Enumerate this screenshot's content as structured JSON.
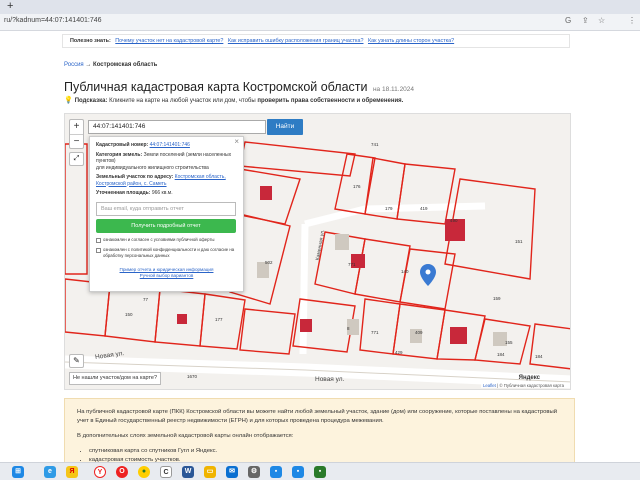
{
  "browser": {
    "new_tab": "+",
    "url": "ru/?kadnum=44:07:141401:746",
    "icons": [
      "translate-icon",
      "share-icon",
      "star-icon",
      "menu-icon"
    ]
  },
  "notice": {
    "label": "Полезно знать:",
    "links": [
      "Почему участок нет на кадастровой карте?",
      "Как исправить ошибку расположения границ участка?",
      "Как узнать длины сторон участка?"
    ]
  },
  "breadcrumb": {
    "root": "Россия",
    "sep": "→",
    "current": "Костромская область"
  },
  "page": {
    "title": "Публичная кадастровая карта Костромской области",
    "date": "на 18.11.2024",
    "hint_label": "Подсказка:",
    "hint_text": "Кликните на карте на любой участок или дом, чтобы",
    "hint_bold": "проверить права собственности и обременения."
  },
  "map": {
    "zoom_in": "+",
    "zoom_out": "−",
    "expand_icon": "⤢",
    "ruler_icon": "✎",
    "search_value": "44:07:141401:746",
    "search_button": "Найти",
    "not_found": "Не нашли участок/дом на карте?",
    "attribution_leaflet": "Leaflet",
    "attribution_rest": "| © Публичная кадастровая карта",
    "yandex": "Яндекс",
    "streets": [
      "Новая ул.",
      "Новая ул.",
      "Каменная ул."
    ],
    "parcel_labels": [
      "741",
      "176",
      "179",
      "419",
      "490",
      "151",
      "502",
      "140",
      "771",
      "159",
      "77",
      "150",
      "177",
      "8",
      "409",
      "771",
      "429",
      "184",
      "155",
      "1670",
      "184"
    ]
  },
  "popup": {
    "close": "×",
    "cad_label": "Кадастровый номер:",
    "cad_value": "44:07:141401:746",
    "cat_label": "Категория земель:",
    "cat_value": "Земли поселений (земли населенных пунктов)",
    "use_value": "для индивидуального жилищного строительства",
    "addr_label": "Земельный участок по адресу:",
    "addr_value": "Костромская область, Костромской район, с. Саметь",
    "area_label": "Уточненная площадь:",
    "area_value": "966 кв.м.",
    "email_placeholder": "Ваш email, куда отправить отчет",
    "get_button": "Получить подробный отчет",
    "agree1": "ознакомлен и согласен с условиями публичной оферты",
    "agree2": "ознакомлен с политикой конфиденциальности и даю согласие на обработку персональных данных",
    "link1": "Пример отчета и юридическая информация",
    "link2": "Ручной выбор вариантов"
  },
  "info": {
    "p1": "На публичной кадастровой карте (ПКК) Костромской области вы можете найти любой земельный участок, здание (дом) или сооружение, которые поставлены на кадастровый учет в Единый государственный реестр недвижимости (ЕГРН) и для которых проведена процедура межевания.",
    "p2": "В дополнительных слоях земельной кадастровой карты онлайн отображается:",
    "items": [
      "спутниковая карта со спутников Гугл и Яндекс.",
      "кадастровая стоимость участков."
    ]
  },
  "taskbar": {
    "icons": [
      "windows-icon",
      "explorer-icon",
      "yandex-icon",
      "opera-icon",
      "chrome-icon",
      "c-icon",
      "word-icon",
      "folder-icon",
      "mail-icon",
      "settings-icon",
      "app-icon",
      "app2-icon",
      "app3-icon"
    ]
  },
  "colors": {
    "parcel": "#e1251b",
    "building": "#c8283a",
    "accent": "#2e7cc4",
    "green": "#3cb84e",
    "info_bg": "#fdf3dd"
  }
}
